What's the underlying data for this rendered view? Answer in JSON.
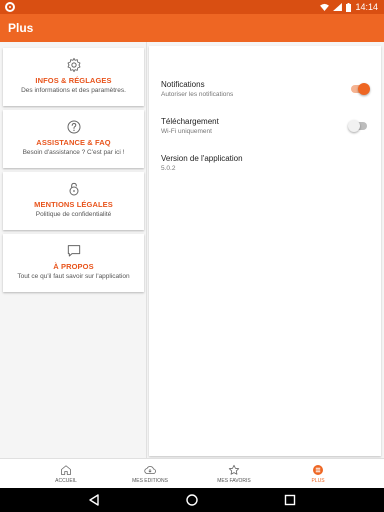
{
  "status_bar": {
    "time": "14:14"
  },
  "app_bar": {
    "title": "Plus"
  },
  "menu_cards": [
    {
      "title": "INFOS & RÉGLAGES",
      "subtitle": "Des informations et des paramètres.",
      "icon": "gear-icon"
    },
    {
      "title": "ASSISTANCE & FAQ",
      "subtitle": "Besoin d'assistance ? C'est par ici !",
      "icon": "question-icon"
    },
    {
      "title": "MENTIONS LÉGALES",
      "subtitle": "Politique de confidentialité",
      "icon": "lock-icon"
    },
    {
      "title": "À PROPOS",
      "subtitle": "Tout ce qu'il faut savoir sur l'application",
      "icon": "chat-bubble-icon"
    }
  ],
  "settings": {
    "notifications": {
      "title": "Notifications",
      "subtitle": "Autoriser les notifications",
      "enabled": true
    },
    "download": {
      "title": "Téléchargement",
      "subtitle": "Wi-Fi uniquement",
      "enabled": false
    },
    "version": {
      "title": "Version de l'application",
      "value": "5.0.2"
    }
  },
  "bottom_nav": [
    {
      "label": "ACCUEIL",
      "icon": "home-icon",
      "active": false
    },
    {
      "label": "MES EDITIONS",
      "icon": "download-icon",
      "active": false
    },
    {
      "label": "MES FAVORIS",
      "icon": "star-icon",
      "active": false
    },
    {
      "label": "PLUS",
      "icon": "menu-icon",
      "active": true
    }
  ],
  "colors": {
    "accent": "#ee6623",
    "status_bar": "#d94f12",
    "card_title": "#e8541c"
  }
}
